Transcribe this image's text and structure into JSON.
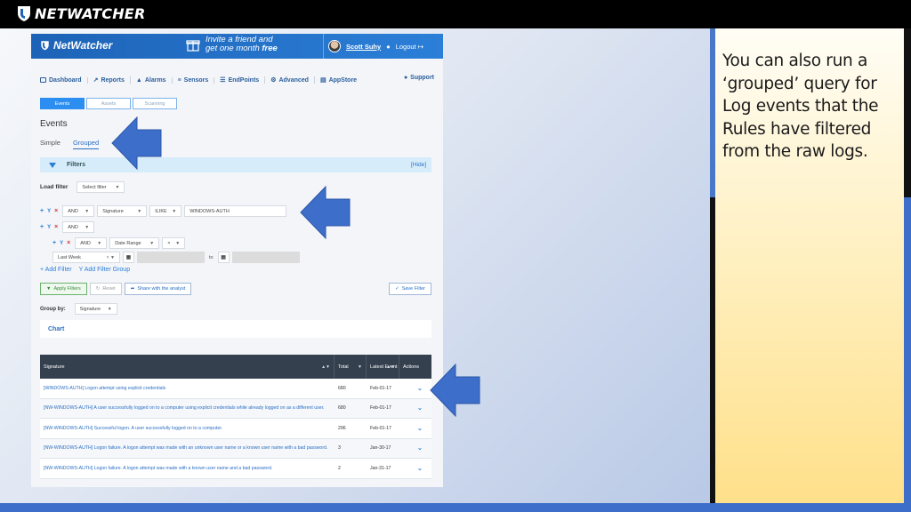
{
  "slide": {
    "brand": "NETWATCHER",
    "note": "You can also run a ‘grouped’ query for Log events that the Rules have filtered from the raw logs."
  },
  "colors": {
    "accent": "#2c8ef0",
    "header": "#1d63b7",
    "arrow": "#3d6ec9",
    "table_header": "#35404f"
  },
  "app": {
    "logo": "NetWatcher",
    "promo_line1": "Invite a friend and",
    "promo_line2_a": "get one month ",
    "promo_line2_b": "free",
    "user_name": "Scott Suhy",
    "bell_icon": "🔔",
    "logout": "Logout"
  },
  "nav": {
    "items": [
      "Dashboard",
      "Reports",
      "Alarms",
      "Sensors",
      "EndPoints",
      "Advanced",
      "AppStore"
    ],
    "support": "Support"
  },
  "tabs": [
    "Events",
    "Assets",
    "Scanning"
  ],
  "page": {
    "title": "Events",
    "subtabs": [
      "Simple",
      "Grouped"
    ]
  },
  "filters": {
    "label": "Filters",
    "hide": "[Hide]",
    "load_label": "Load filter",
    "load_placeholder": "Select filter",
    "row1": {
      "op": "AND",
      "field": "Signature",
      "cmp": "ILIKE",
      "value": "WINDOWS-AUTH"
    },
    "row2": {
      "op": "AND"
    },
    "row3": {
      "op": "AND",
      "field": "Date Range",
      "cmp": "×"
    },
    "row4": {
      "range": "Last Week",
      "clear": "×",
      "to": "to"
    },
    "add_filter": "Add Filter",
    "add_group": "Add Filter Group"
  },
  "buttons": {
    "apply": "Apply Filters",
    "reset": "Reset",
    "share": "Share with the analyst",
    "save": "Save Filter"
  },
  "group_by": {
    "label": "Group by:",
    "value": "Signature"
  },
  "chart_label": "Chart",
  "table": {
    "headers": [
      "Signature",
      "Total",
      "Latest Event",
      "Actions"
    ],
    "rows": [
      {
        "signature": "[WINDOWS-AUTH] Logon attempt using explicit credentials",
        "total": "680",
        "latest": "Feb-01-17"
      },
      {
        "signature": "[NW-WINDOWS-AUTH] A user successfully logged on to a computer using explicit credentials while already logged on as a different user.",
        "total": "680",
        "latest": "Feb-01-17"
      },
      {
        "signature": "[NW-WINDOWS-AUTH] Successful logon. A user successfully logged on to a computer.",
        "total": "296",
        "latest": "Feb-01-17"
      },
      {
        "signature": "[NW-WINDOWS-AUTH] Logon failure. A logon attempt was made with an unknown user name or a known user name with a bad password.",
        "total": "3",
        "latest": "Jan-30-17"
      },
      {
        "signature": "[NW-WINDOWS-AUTH] Logon failure. A logon attempt was made with a known user name and a bad password.",
        "total": "2",
        "latest": "Jan-31-17"
      }
    ]
  }
}
